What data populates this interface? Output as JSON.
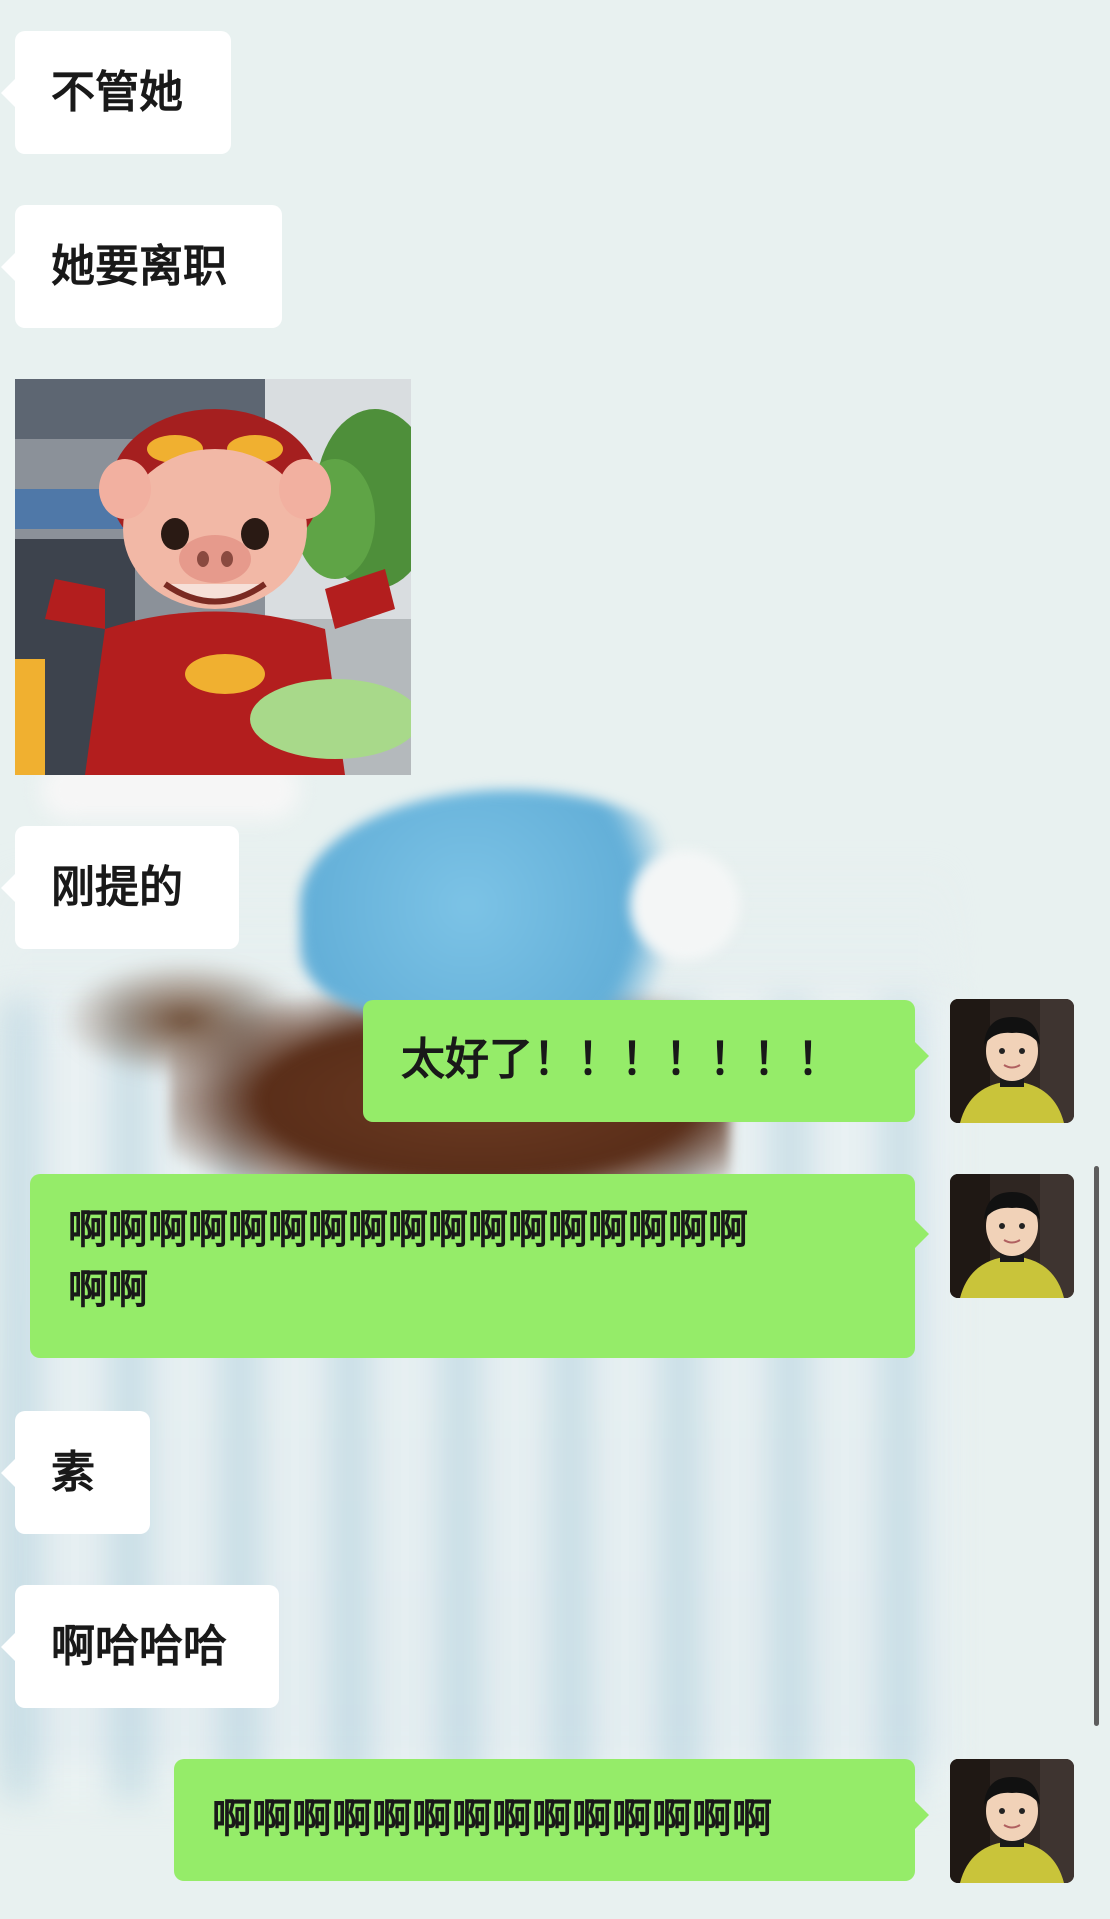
{
  "colors": {
    "background": "#e8f1f0",
    "incoming_bubble": "#ffffff",
    "outgoing_bubble": "#95ec69",
    "text": "#191919"
  },
  "messages": [
    {
      "side": "incoming",
      "text": "不管她"
    },
    {
      "side": "incoming",
      "text": "她要离职"
    },
    {
      "side": "incoming",
      "type": "sticker",
      "icon": "cartoon-pig-sticker"
    },
    {
      "side": "incoming",
      "text": "刚提的"
    },
    {
      "side": "outgoing",
      "text": "太好了！！！！！！！",
      "avatar": "boy-avatar"
    },
    {
      "side": "outgoing",
      "text": "啊啊啊啊啊啊啊啊啊啊啊啊啊啊啊啊啊",
      "text_line2": "啊啊",
      "avatar": "boy-avatar"
    },
    {
      "side": "incoming",
      "text": "素"
    },
    {
      "side": "incoming",
      "text": "啊哈哈哈"
    },
    {
      "side": "outgoing",
      "text": "啊啊啊啊啊啊啊啊啊啊啊啊啊啊",
      "avatar": "boy-avatar"
    }
  ]
}
